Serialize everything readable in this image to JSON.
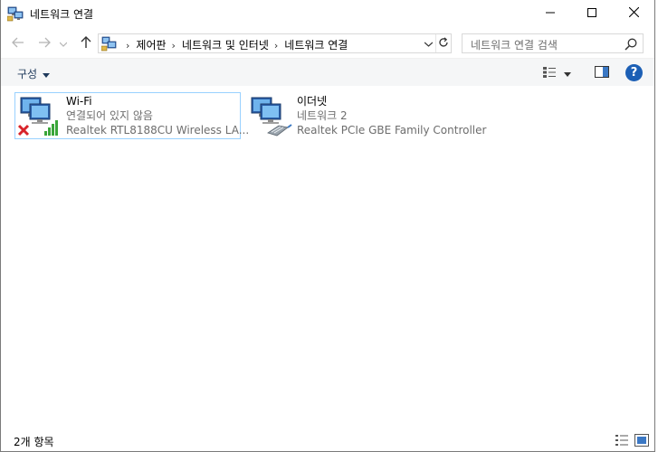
{
  "window": {
    "title": "네트워크 연결",
    "minimize_icon": "minimize-icon",
    "maximize_icon": "maximize-icon",
    "close_icon": "close-icon"
  },
  "navigation": {
    "back_icon": "arrow-left-icon",
    "forward_icon": "arrow-right-icon",
    "recent_icon": "chevron-down-icon",
    "up_icon": "arrow-up-icon"
  },
  "address_bar": {
    "breadcrumbs": [
      "제어판",
      "네트워크 및 인터넷",
      "네트워크 연결"
    ],
    "separator": "›"
  },
  "search": {
    "placeholder": "네트워크 연결 검색"
  },
  "command_bar": {
    "organize_label": "구성",
    "help_label": "?"
  },
  "items": [
    {
      "name": "Wi-Fi",
      "status": "연결되어 있지 않음",
      "device": "Realtek RTL8188CU Wireless LA...",
      "icon": "wifi-adapter-icon",
      "overlay_icon": "disconnected-x-icon",
      "selected": true
    },
    {
      "name": "이더넷",
      "status": "네트워크 2",
      "device": "Realtek PCIe GBE Family Controller",
      "icon": "ethernet-adapter-icon",
      "selected": false
    }
  ],
  "status_bar": {
    "item_count": "2개 항목"
  },
  "colors": {
    "accent": "#1c5fb5",
    "selection_border": "#99d1ff",
    "secondary_text": "#6d6d6d",
    "error_red": "#d8232a",
    "signal_green": "#3aa63a"
  }
}
